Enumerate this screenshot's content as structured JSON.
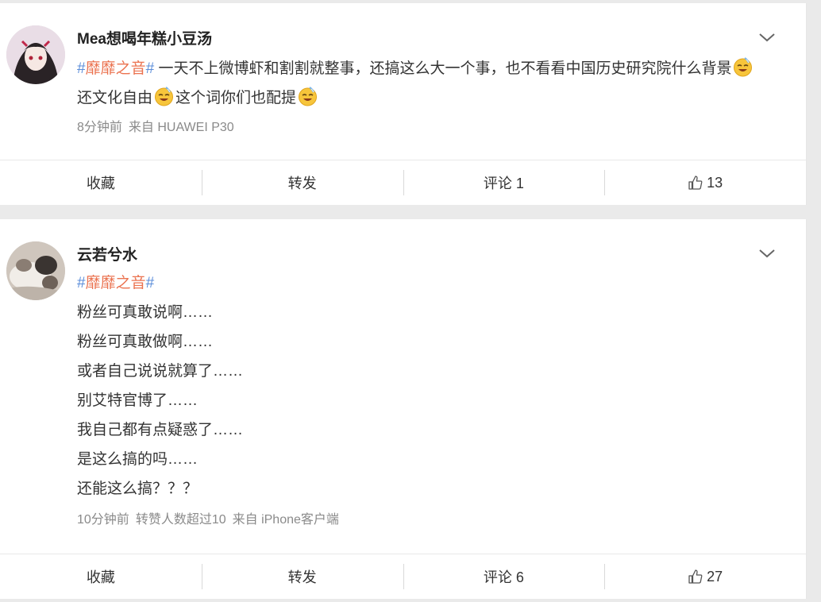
{
  "posts": [
    {
      "username": "Mea想喝年糕小豆汤",
      "hashtag": "靡靡之音",
      "text_parts": [
        "一天不上微博虾和割割就整事，还搞这么大一个事，也不看看中国历史研究院什么背景",
        "还文化自由",
        "这个词你们也配提"
      ],
      "emoji_icon": "grinning-sweat-emoji-icon",
      "meta": [
        "8分钟前",
        "来自 HUAWEI P30"
      ],
      "actions": {
        "favorite": "收藏",
        "repost": "转发",
        "comment": "评论 1",
        "like": "13"
      }
    },
    {
      "username": "云若兮水",
      "hashtag": "靡靡之音",
      "lines": [
        "粉丝可真敢说啊……",
        "粉丝可真敢做啊……",
        "或者自己说说就算了……",
        "别艾特官博了……",
        "我自己都有点疑惑了……",
        "是这么搞的吗……",
        "还能这么搞？？？"
      ],
      "meta": [
        "10分钟前",
        "转赞人数超过10",
        "来自 iPhone客户端"
      ],
      "actions": {
        "favorite": "收藏",
        "repost": "转发",
        "comment": "评论 6",
        "like": "27"
      }
    }
  ],
  "colors": {
    "hashtag_text": "#eb7350",
    "hashtag_hash": "#5b8dd9",
    "meta": "#8a8a8a"
  }
}
